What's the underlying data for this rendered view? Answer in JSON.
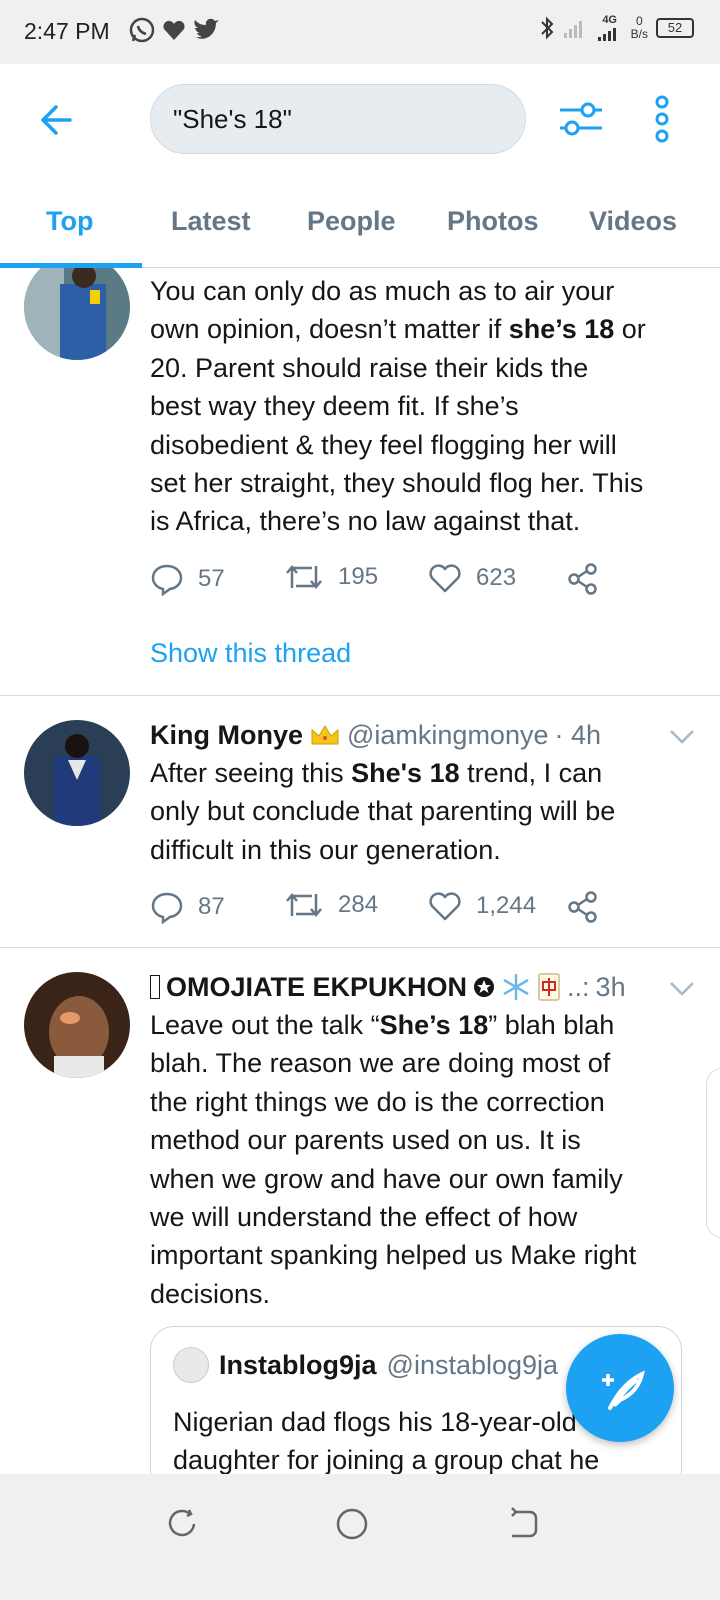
{
  "status_bar": {
    "time": "2:47 PM",
    "app_icons": [
      "whatsapp-icon",
      "heart-icon",
      "twitter-icon"
    ],
    "network_label": "4G",
    "speed_value": "0",
    "speed_unit": "B/s",
    "battery": "52"
  },
  "header": {
    "search_query": "\"She's 18\""
  },
  "tabs": [
    "Top",
    "Latest",
    "People",
    "Photos",
    "Videos"
  ],
  "tweets": [
    {
      "lines": [
        "You can only do as much as to air your",
        "own opinion, doesn’t matter if <b>she’s 18</b> or",
        "20. Parent should raise their kids the",
        "best way they deem fit. If she’s",
        "disobedient & they feel flogging her will",
        "set her straight, they should flog her. This",
        "is Africa, there’s no law against that."
      ],
      "replies": "57",
      "retweets": "195",
      "likes": "623",
      "show_thread": "Show this thread"
    },
    {
      "author": "King Monye",
      "handle": "@iamkingmonye",
      "time": "· 4h",
      "lines": [
        "After seeing this <b>She's 18</b> trend, I can",
        "only but conclude that parenting will be",
        "difficult in this our generation."
      ],
      "replies": "87",
      "retweets": "284",
      "likes": "1,244"
    },
    {
      "author": "OMOJIATE EKPUKHON",
      "handle": "..:",
      "time": "3h",
      "lines": [
        "Leave out the talk “<b>She’s 18</b>” blah blah",
        "blah. The reason we are doing most of",
        "the right things we do is the correction",
        "method our parents used on us. It is",
        "when we grow and have our own family",
        "we will understand the effect of how",
        "important spanking helped us Make right",
        "decisions."
      ],
      "quote": {
        "author": "Instablog9ja",
        "handle": "@instablog9ja",
        "text": "Nigerian dad flogs his 18-year-old daughter for joining a group chat he"
      }
    }
  ],
  "colors": {
    "accent": "#1da1f2",
    "secondary_text": "#657786",
    "divider": "#d8dee2"
  }
}
